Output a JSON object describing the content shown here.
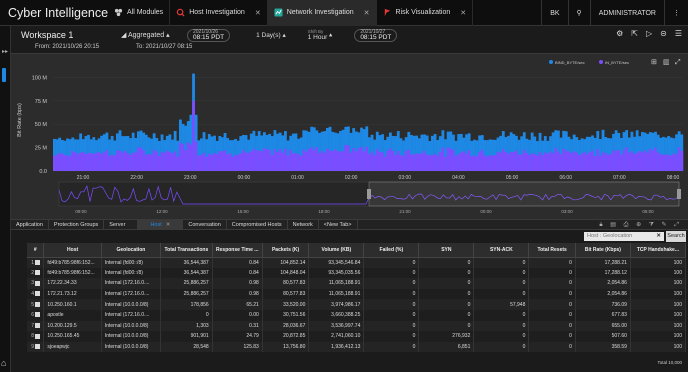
{
  "app": {
    "title": "Cyber Intelligence"
  },
  "tabs": [
    {
      "label": "All Modules",
      "closable": false,
      "active": false,
      "icon": "modules-icon"
    },
    {
      "label": "Host Investigation",
      "closable": true,
      "active": false,
      "icon": "search-icon"
    },
    {
      "label": "Network Investigation",
      "closable": true,
      "active": true,
      "icon": "network-icon"
    },
    {
      "label": "Risk Visualization",
      "closable": true,
      "active": false,
      "icon": "risk-icon"
    }
  ],
  "topright": {
    "initials": "BK",
    "user": "ADMINISTRATOR"
  },
  "workspace": {
    "name": "Workspace 1",
    "aggregation": "Aggregated",
    "start_date": "2021/10/26",
    "start_time": "08:15 PDT",
    "range": "1 Day(s)",
    "shift_label": "Shift By",
    "shift": "1 Hour",
    "end_date": "2021/10/27",
    "end_time": "08:15 PDT"
  },
  "dates": {
    "from": "From: 2021/10/26 20:15",
    "to": "To: 2021/10/27 08:15"
  },
  "chart_data": {
    "type": "bar",
    "ylabel": "Bit Rate (bps)",
    "y_ticks": [
      "100 M",
      "75 M",
      "50 M",
      "25 M",
      "0.0"
    ],
    "x_ticks": [
      "21:00",
      "22:00",
      "23:00",
      "00:00",
      "01:00",
      "02:00",
      "03:00",
      "04:00",
      "05:00",
      "06:00",
      "07:00",
      "08:00"
    ],
    "overview_ticks": [
      "09:00",
      "12:00",
      "15:00",
      "18:00",
      "21:00",
      "00:00",
      "03:00",
      "06:00"
    ],
    "ylim": [
      0,
      110
    ],
    "legend": [
      "BIND_BYTE/sec",
      "IN_BYTE/sec"
    ],
    "colors": {
      "out": "#1e88e5",
      "in": "#7c4dff"
    },
    "series_out_peak_M": 104,
    "series_typical_M": 38
  },
  "subtabs": [
    {
      "label": "Application",
      "active": false,
      "closable": false
    },
    {
      "label": "Protection Groups",
      "active": false,
      "closable": false
    },
    {
      "label": "Server",
      "active": false,
      "closable": false
    },
    {
      "label": "Host",
      "active": true,
      "closable": true
    },
    {
      "label": "Conversation",
      "active": false,
      "closable": false
    },
    {
      "label": "Compromised Hosts",
      "active": false,
      "closable": false
    },
    {
      "label": "Network",
      "active": false,
      "closable": false
    },
    {
      "label": "<New Tab>",
      "active": false,
      "closable": false
    }
  ],
  "search": {
    "placeholder": "Host : Geolocation",
    "button": "Search"
  },
  "table": {
    "headers": [
      "#",
      "Host",
      "Geolocation",
      "Total Transactions",
      "Response Time ...",
      "Packets (K)",
      "Volume (KB)",
      "Failed (%)",
      "SYN",
      "SYN-ACK",
      "Total Resets",
      "Bit Rate (Kbps)",
      "TCP Handshake..."
    ],
    "rows": [
      [
        "1",
        "fd49:b785:98f6:152...",
        "Internal (fd00::/8)",
        "36,544,387",
        "0.84",
        "104,852.14",
        "93,345,546.84",
        "0",
        "0",
        "0",
        "0",
        "17,288.21",
        "100"
      ],
      [
        "2",
        "fd49:b785:98f6:152...",
        "Internal (fd00::/8)",
        "36,544,387",
        "0.84",
        "104,848.04",
        "93,345,035.56",
        "0",
        "0",
        "0",
        "0",
        "17,288.12",
        "100"
      ],
      [
        "3",
        "172.22.34.33",
        "Internal (172.16.0....",
        "25,886,257",
        "0.98",
        "80,577.83",
        "11,065,188.91",
        "0",
        "0",
        "0",
        "0",
        "2,054.86",
        "100"
      ],
      [
        "4",
        "172.21.73.12",
        "Internal (172.16.0....",
        "25,886,257",
        "0.98",
        "80,577.83",
        "11,065,188.91",
        "0",
        "0",
        "0",
        "0",
        "2,054.86",
        "100"
      ],
      [
        "5",
        "10.250.160.1",
        "Internal (10.0.0.0/8)",
        "178,856",
        "65.21",
        "33,520.00",
        "3,974,986.17",
        "0",
        "0",
        "57,948",
        "0",
        "736.09",
        "100"
      ],
      [
        "6",
        "apostle",
        "Internal (172.16.0....",
        "0",
        "0.00",
        "30,751.56",
        "3,660,388.25",
        "0",
        "0",
        "0",
        "0",
        "677.83",
        "100"
      ],
      [
        "7",
        "10.200.129.5",
        "Internal (10.0.0.0/8)",
        "1,303",
        "0.31",
        "28,036.67",
        "3,536,997.74",
        "0",
        "0",
        "0",
        "0",
        "655.00",
        "100"
      ],
      [
        "8",
        "10.250.165.45",
        "Internal (10.0.0.0/8)",
        "901,901",
        "24.79",
        "20,872.85",
        "2,741,060.10",
        "0",
        "276,932",
        "0",
        "0",
        "507.60",
        "100"
      ],
      [
        "9",
        "sjoeapwjc",
        "Internal (10.0.0.0/8)",
        "28,548",
        "125.83",
        "13,756.80",
        "1,936,412.13",
        "0",
        "6,851",
        "0",
        "0",
        "358.59",
        "100"
      ]
    ]
  },
  "footer": {
    "total": "Total 10,000"
  }
}
